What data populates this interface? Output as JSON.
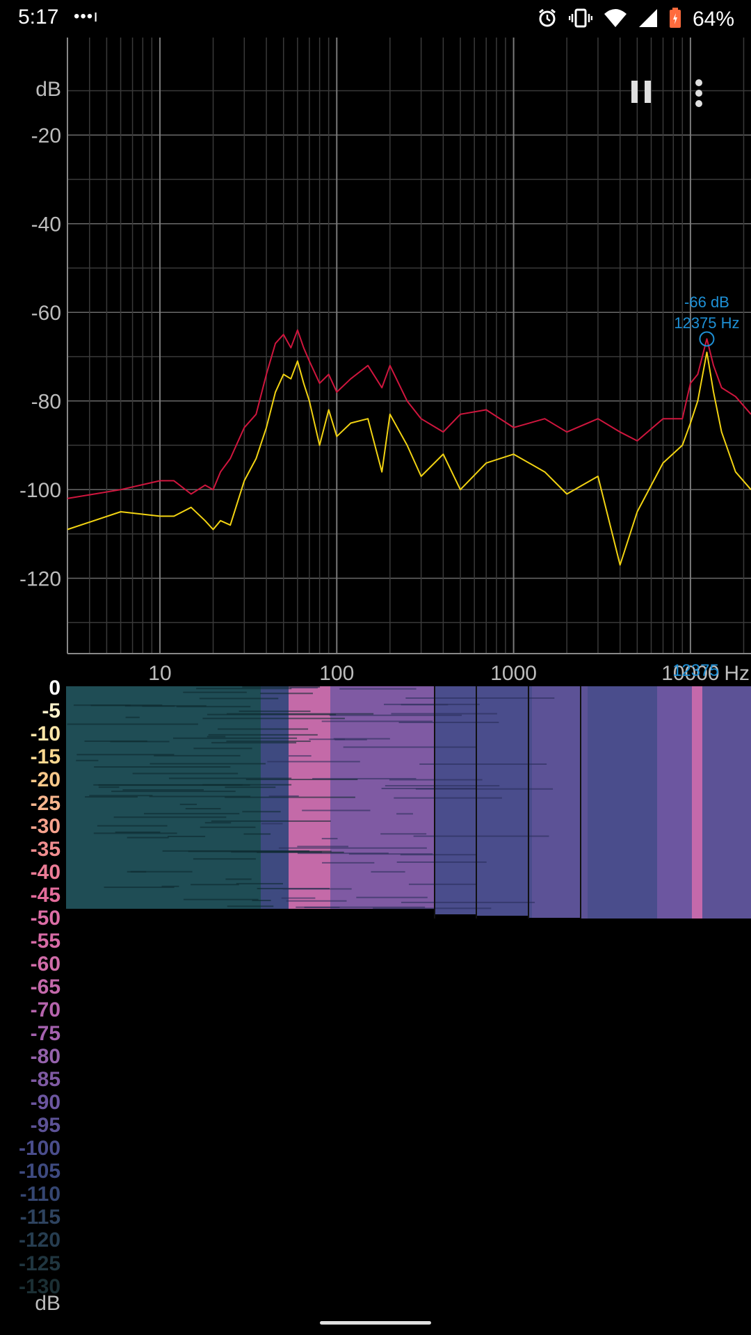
{
  "status_bar": {
    "time": "5:17",
    "signal_dots": "•••ı",
    "battery_percent": "64%",
    "icons": [
      "alarm-icon",
      "vibrate-icon",
      "wifi-icon",
      "cell-signal-icon",
      "battery-charging-icon"
    ]
  },
  "toolbar": {
    "pause_icon": "pause-icon",
    "menu_icon": "more-vert-icon"
  },
  "spectrum": {
    "y_unit": "dB",
    "y_ticks": [
      "-20",
      "-40",
      "-60",
      "-80",
      "-100",
      "-120"
    ],
    "x_ticks": [
      "10",
      "100",
      "1000",
      "10000"
    ],
    "x_unit": "Hz",
    "peak_db": "-66 dB",
    "peak_hz": "12375 Hz",
    "peak_marker": "12375",
    "colors": {
      "peak_hold": "#d0163e",
      "live": "#f2d312",
      "marker": "#1e90d6",
      "grid": "#555555"
    }
  },
  "chart_data": {
    "type": "line",
    "x_scale": "log",
    "xlim": [
      3,
      22000
    ],
    "ylim": [
      -137,
      2
    ],
    "grid": true,
    "series": [
      {
        "color": "#d0163e",
        "x": [
          3,
          6,
          10,
          12,
          15,
          18,
          20,
          22,
          25,
          30,
          35,
          40,
          45,
          50,
          55,
          60,
          65,
          70,
          80,
          90,
          100,
          120,
          150,
          180,
          200,
          250,
          300,
          400,
          500,
          700,
          1000,
          1500,
          2000,
          3000,
          4000,
          5000,
          7000,
          9000,
          10000,
          11000,
          12375,
          13500,
          15000,
          18000,
          22000
        ],
        "y": [
          -102,
          -100,
          -98,
          -98,
          -101,
          -99,
          -100,
          -96,
          -93,
          -86,
          -83,
          -74,
          -67,
          -65,
          -68,
          -64,
          -68,
          -71,
          -76,
          -74,
          -78,
          -75,
          -72,
          -77,
          -72,
          -80,
          -84,
          -87,
          -83,
          -82,
          -86,
          -84,
          -87,
          -84,
          -87,
          -89,
          -84,
          -84,
          -76,
          -74,
          -66,
          -72,
          -77,
          -79,
          -83
        ]
      },
      {
        "color": "#f2d312",
        "x": [
          3,
          6,
          10,
          12,
          15,
          18,
          20,
          22,
          25,
          30,
          35,
          40,
          45,
          50,
          55,
          60,
          65,
          70,
          80,
          90,
          100,
          120,
          150,
          180,
          200,
          250,
          300,
          400,
          500,
          700,
          1000,
          1500,
          2000,
          3000,
          4000,
          5000,
          7000,
          9000,
          10000,
          11000,
          12375,
          13500,
          15000,
          18000,
          22000
        ],
        "y": [
          -109,
          -105,
          -106,
          -106,
          -104,
          -107,
          -109,
          -107,
          -108,
          -98,
          -93,
          -86,
          -78,
          -74,
          -75,
          -71,
          -76,
          -80,
          -90,
          -82,
          -88,
          -85,
          -84,
          -96,
          -83,
          -90,
          -97,
          -92,
          -100,
          -94,
          -92,
          -96,
          -101,
          -97,
          -117,
          -105,
          -94,
          -90,
          -85,
          -80,
          -69,
          -78,
          -87,
          -96,
          -100
        ]
      }
    ],
    "annotations": [
      {
        "x": 12375,
        "y": -66,
        "label": "-66 dB 12375 Hz"
      }
    ]
  },
  "spectrogram": {
    "legend": [
      "0",
      "-5",
      "-10",
      "-15",
      "-20",
      "-25",
      "-30",
      "-35",
      "-40",
      "-45",
      "-50",
      "-55",
      "-60",
      "-65",
      "-70",
      "-75",
      "-80",
      "-85",
      "-90",
      "-95",
      "-100",
      "-105",
      "-110",
      "-115",
      "-120",
      "-125",
      "-130"
    ],
    "legend_colors": [
      "#ffffff",
      "#fff3cc",
      "#fde6a8",
      "#fcd890",
      "#fbc98a",
      "#f9b68e",
      "#f6a28d",
      "#f18d8f",
      "#ec7c96",
      "#e36c9c",
      "#dc6da6",
      "#d76ba6",
      "#d06ca9",
      "#c469ab",
      "#b664ad",
      "#a461ae",
      "#9562ac",
      "#7f5aa3",
      "#6c56a0",
      "#5c5296",
      "#4a4d8c",
      "#3e4a80",
      "#354672",
      "#2e435f",
      "#263d50",
      "#203640",
      "#1b2f34"
    ],
    "db_unit": "dB"
  }
}
